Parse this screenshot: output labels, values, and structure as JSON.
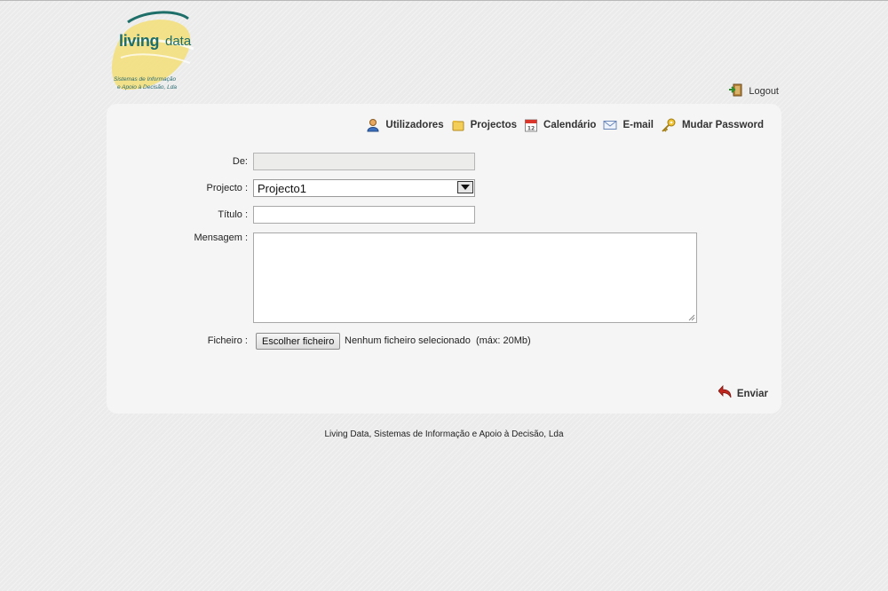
{
  "logo": {
    "brand_living": "living",
    "brand_data": "data",
    "subtitle_line1": "Sistemas de Informação",
    "subtitle_line2": "e Apoio à Decisão, Lda"
  },
  "header": {
    "logout_label": "Logout"
  },
  "nav": {
    "items": [
      {
        "label": "Utilizadores",
        "icon": "user-icon"
      },
      {
        "label": "Projectos",
        "icon": "folder-icon"
      },
      {
        "label": "Calendário",
        "icon": "calendar-icon"
      },
      {
        "label": "E-mail",
        "icon": "email-icon"
      },
      {
        "label": "Mudar Password",
        "icon": "key-icon"
      }
    ]
  },
  "form": {
    "de_label": "De:",
    "de_value": "",
    "projecto_label": "Projecto :",
    "projecto_value": "Projecto1",
    "titulo_label": "Título :",
    "titulo_value": "",
    "mensagem_label": "Mensagem :",
    "mensagem_value": "",
    "ficheiro_label": "Ficheiro :",
    "ficheiro_button": "Escolher ficheiro",
    "ficheiro_status": "Nenhum ficheiro selecionado",
    "ficheiro_max": "(máx: 20Mb)",
    "submit_label": "Enviar"
  },
  "footer": {
    "text": "Living Data, Sistemas de Informação e Apoio à Decisão, Lda"
  },
  "colors": {
    "brand_teal": "#1e6e6a",
    "logo_yellow": "#f4e07a",
    "panel_bg": "#f5f5f5"
  }
}
